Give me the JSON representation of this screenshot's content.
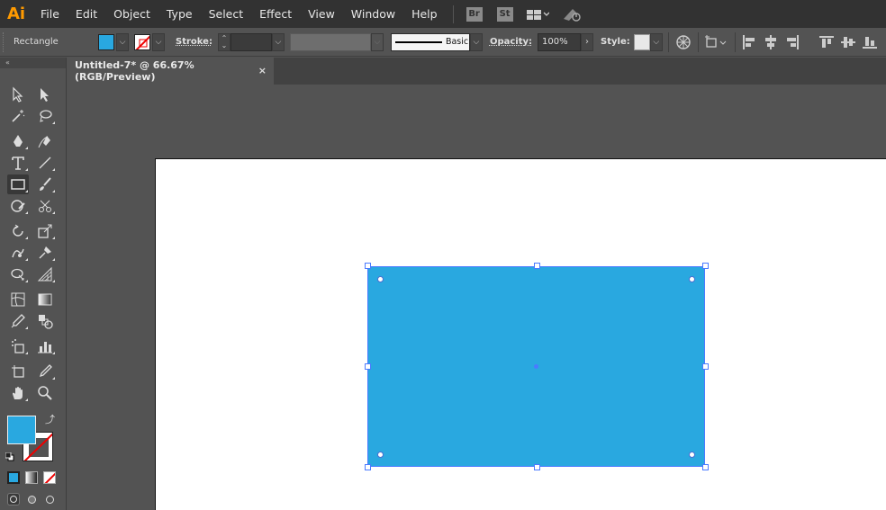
{
  "app": {
    "logo": "Ai",
    "menu": [
      "File",
      "Edit",
      "Object",
      "Type",
      "Select",
      "Effect",
      "View",
      "Window",
      "Help"
    ],
    "bridge": "Br",
    "stock": "St"
  },
  "control_bar": {
    "tool_name": "Rectangle",
    "fill_color": "#29a8e0",
    "stroke_label": "Stroke:",
    "stroke_weight": "",
    "brush_name": "Basic",
    "opacity_label": "Opacity:",
    "opacity_value": "100%",
    "style_label": "Style:"
  },
  "document": {
    "tab_title": "Untitled-7* @ 66.67% (RGB/Preview)",
    "close_glyph": "×"
  },
  "canvas": {
    "selected_shape_fill": "#29a8e0",
    "selection_color": "#4a7bff"
  },
  "toolpanel": {
    "collapse_glyph": "«",
    "fill_swatch": "#29a8e0",
    "stroke_swatch": "none",
    "tools": [
      "selection-tool",
      "direct-selection-tool",
      "magic-wand-tool",
      "lasso-tool",
      "pen-tool",
      "curvature-tool",
      "type-tool",
      "line-segment-tool",
      "rectangle-tool",
      "paintbrush-tool",
      "shaper-tool",
      "scissors-tool",
      "rotate-tool",
      "scale-tool",
      "warp-tool",
      "puppet-warp-tool",
      "shape-builder-tool",
      "perspective-grid-tool",
      "mesh-tool",
      "gradient-tool",
      "eyedropper-tool",
      "blend-tool",
      "symbol-sprayer-tool",
      "column-graph-tool",
      "artboard-tool",
      "slice-tool",
      "hand-tool",
      "zoom-tool"
    ]
  }
}
